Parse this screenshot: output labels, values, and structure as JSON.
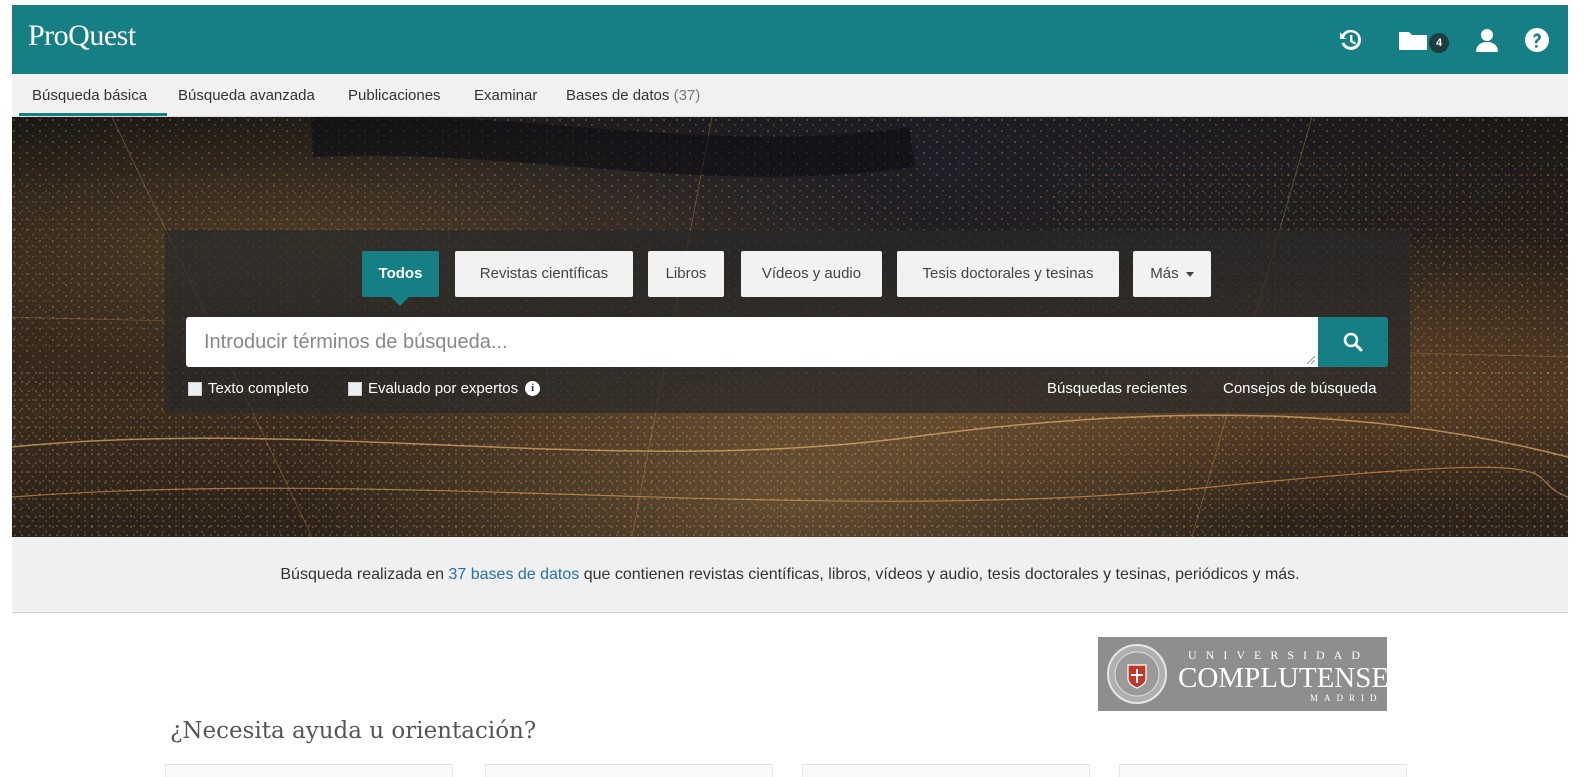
{
  "header": {
    "logo": "ProQuest",
    "icons": [
      "history-icon",
      "folder-icon",
      "user-icon",
      "help-icon"
    ],
    "folder_count": "4",
    "bg_color": "#167f86"
  },
  "nav": {
    "items": [
      {
        "label": "Búsqueda básica",
        "active": true
      },
      {
        "label": "Búsqueda avanzada",
        "active": false
      },
      {
        "label": "Publicaciones",
        "active": false
      },
      {
        "label": "Examinar",
        "active": false
      },
      {
        "label": "Bases de datos",
        "active": false
      }
    ],
    "databases_count": "(37)"
  },
  "search": {
    "tabs": [
      {
        "label": "Todos",
        "active": true
      },
      {
        "label": "Revistas científicas",
        "active": false
      },
      {
        "label": "Libros",
        "active": false
      },
      {
        "label": "Vídeos y audio",
        "active": false
      },
      {
        "label": "Tesis doctorales y tesinas",
        "active": false
      },
      {
        "label": "Más",
        "active": false
      }
    ],
    "placeholder": "Introducir términos de búsqueda...",
    "options": {
      "full_text": "Texto completo",
      "peer_reviewed": "Evaluado por expertos",
      "info_glyph": "i"
    },
    "recent_searches": "Búsquedas recientes",
    "search_tips": "Consejos de búsqueda"
  },
  "info": {
    "before": "Búsqueda realizada en ",
    "link": "37 bases de datos",
    "after": " que contienen revistas científicas, libros, vídeos y audio, tesis doctorales y tesinas, periódicos y más."
  },
  "institution": {
    "line1": "UNIVERSIDAD",
    "line2": "COMPLUTENSE",
    "line3": "MADRID"
  },
  "help": {
    "title": "¿Necesita ayuda u orientación?"
  }
}
